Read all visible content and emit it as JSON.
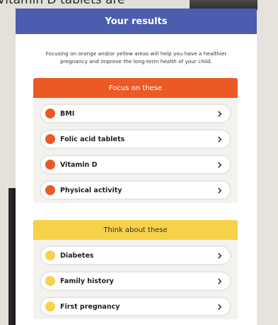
{
  "background": {
    "caption_text": "Vitamin D tablets are"
  },
  "header": {
    "title": "Your results"
  },
  "intro": "Focusing on orange and/or yellow areas will help you have a healthier pregnancy and improve the long-term health of your child.",
  "focus_section": {
    "title": "Focus on these",
    "color": "#eb5a24",
    "items": [
      {
        "label": "BMI",
        "icon": "orange-dot-icon"
      },
      {
        "label": "Folic acid tablets",
        "icon": "orange-dot-icon"
      },
      {
        "label": "Vitamin D",
        "icon": "orange-dot-icon"
      },
      {
        "label": "Physical activity",
        "icon": "orange-dot-icon"
      }
    ]
  },
  "think_section": {
    "title": "Think about these",
    "color": "#f6d24a",
    "items": [
      {
        "label": "Diabetes",
        "icon": "yellow-dot-icon"
      },
      {
        "label": "Family history",
        "icon": "yellow-dot-icon"
      },
      {
        "label": "First pregnancy",
        "icon": "yellow-dot-icon"
      }
    ]
  }
}
